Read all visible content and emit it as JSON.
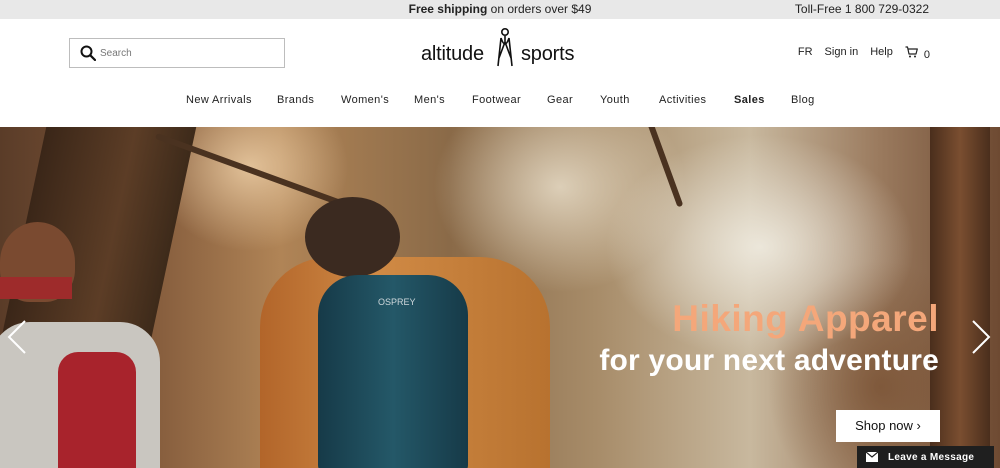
{
  "topbar": {
    "shipping_bold": "Free shipping",
    "shipping_rest": " on orders over $49",
    "phone": "Toll-Free 1 800 729-0322"
  },
  "search": {
    "placeholder": "Search"
  },
  "logo": {
    "word1": "altitude",
    "word2": "sports"
  },
  "utils": {
    "lang": "FR",
    "signin": "Sign in",
    "help": "Help",
    "cart_count": "0"
  },
  "nav": {
    "items": [
      "New Arrivals",
      "Brands",
      "Women's",
      "Men's",
      "Footwear",
      "Gear",
      "Youth",
      "Activities",
      "Sales",
      "Blog"
    ]
  },
  "hero": {
    "title": "Hiking Apparel",
    "subtitle": "for your next adventure",
    "cta": "Shop now ›",
    "pack_logo": "OSPREY"
  },
  "chat": {
    "label": "Leave a Message"
  },
  "colors": {
    "accent": "#f4a77a",
    "topbar_bg": "#e8e8e8",
    "chat_bg": "#1f1f1f"
  }
}
